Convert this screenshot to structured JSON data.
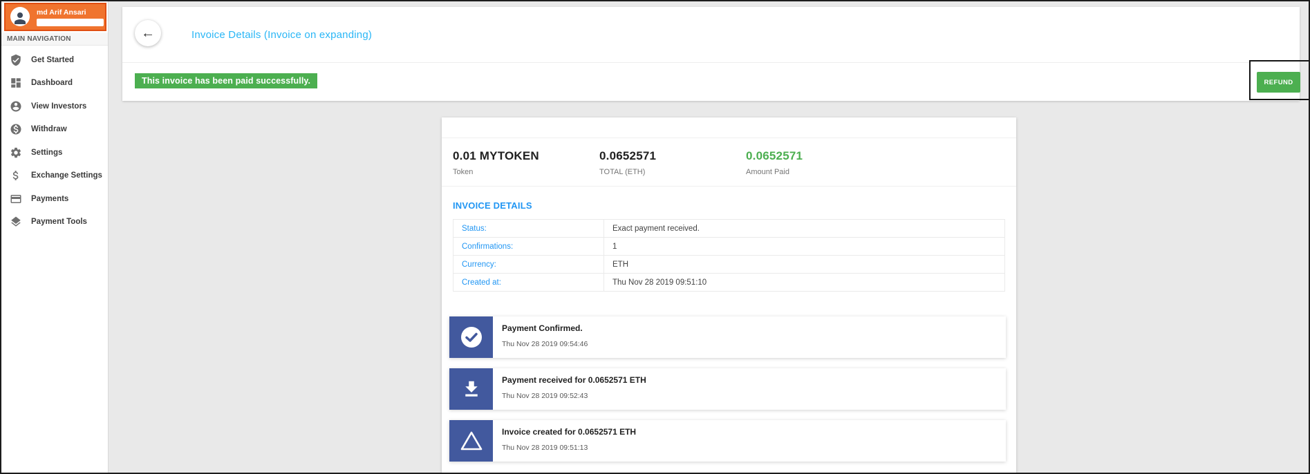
{
  "user": {
    "name": "md Arif Ansari"
  },
  "sidebar": {
    "section_label": "MAIN NAVIGATION",
    "items": [
      {
        "label": "Get Started",
        "icon": "shield-check-icon"
      },
      {
        "label": "Dashboard",
        "icon": "dashboard-icon"
      },
      {
        "label": "View Investors",
        "icon": "person-circle-icon"
      },
      {
        "label": "Withdraw",
        "icon": "dollar-circle-icon"
      },
      {
        "label": "Settings",
        "icon": "gear-icon"
      },
      {
        "label": "Exchange Settings",
        "icon": "dollar-icon"
      },
      {
        "label": "Payments",
        "icon": "credit-card-icon"
      },
      {
        "label": "Payment Tools",
        "icon": "layers-icon"
      }
    ]
  },
  "header": {
    "back_icon": "arrow-left-icon",
    "title": "Invoice Details (Invoice on expanding)",
    "banner": "This invoice has been paid successfully.",
    "refund_label": "REFUND"
  },
  "invoice": {
    "summary": [
      {
        "value": "0.01 MYTOKEN",
        "label": "Token"
      },
      {
        "value": "0.0652571",
        "label": "TOTAL (ETH)"
      },
      {
        "value": "0.0652571",
        "label": "Amount Paid"
      }
    ],
    "details_heading": "INVOICE DETAILS",
    "details": [
      {
        "label": "Status:",
        "value": "Exact payment received."
      },
      {
        "label": "Confirmations:",
        "value": "1"
      },
      {
        "label": "Currency:",
        "value": "ETH"
      },
      {
        "label": "Created at:",
        "value": "Thu Nov 28 2019 09:51:10"
      }
    ],
    "timeline": [
      {
        "icon": "check-circle-icon",
        "title": "Payment Confirmed.",
        "timestamp": "Thu Nov 28 2019 09:54:46"
      },
      {
        "icon": "download-icon",
        "title": "Payment received for 0.0652571 ETH",
        "timestamp": "Thu Nov 28 2019 09:52:43"
      },
      {
        "icon": "triangle-icon",
        "title": "Invoice created for 0.0652571 ETH",
        "timestamp": "Thu Nov 28 2019 09:51:13"
      }
    ]
  },
  "colors": {
    "header_orange": "#f0742e",
    "annotation_orange": "#e04e12",
    "title_blue": "#29b6f6",
    "link_blue": "#2196f3",
    "success_green": "#4caf50",
    "timeline_indigo": "#42599e",
    "background_grey": "#e9e9e9"
  }
}
